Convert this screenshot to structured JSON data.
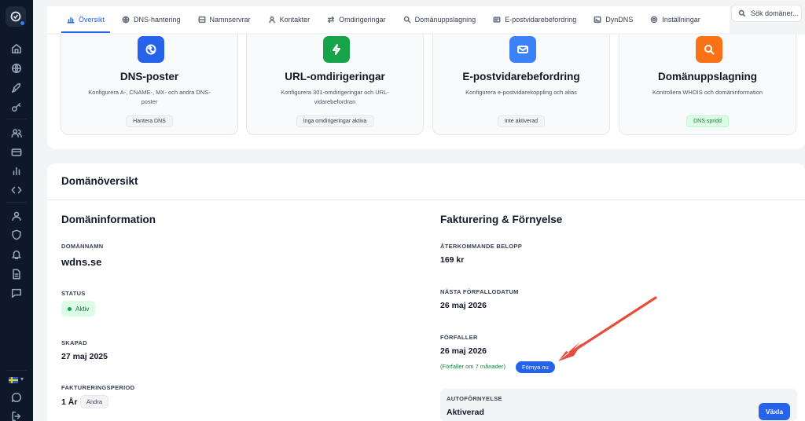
{
  "tabs": [
    {
      "label": "Översikt",
      "icon": "chart-icon",
      "active": true
    },
    {
      "label": "DNS-hantering",
      "icon": "globe-icon"
    },
    {
      "label": "Namnservrar",
      "icon": "server-icon"
    },
    {
      "label": "Kontakter",
      "icon": "user-icon"
    },
    {
      "label": "Omdirigeringar",
      "icon": "arrows-icon"
    },
    {
      "label": "Domänuppslagning",
      "icon": "search-icon"
    },
    {
      "label": "E-postvidarebefordring",
      "icon": "mail-icon"
    },
    {
      "label": "DynDNS",
      "icon": "terminal-icon"
    },
    {
      "label": "Inställningar",
      "icon": "gear-icon"
    }
  ],
  "search": {
    "placeholder": "Sök domäner..."
  },
  "services": [
    {
      "title": "DNS-poster",
      "desc": "Konfigurera A-, CNAME-, MX- och andra DNS-poster",
      "badge": "Hantera DNS",
      "color": "#2563eb",
      "icon": "dns-icon"
    },
    {
      "title": "URL-omdirigeringar",
      "desc": "Konfigurera 301-omdirigeringar och URL-vidarebefordran",
      "badge": "Inga omdirigeringar aktiva",
      "color": "#16a34a",
      "icon": "bolt-icon"
    },
    {
      "title": "E-postvidarebefordring",
      "desc": "Konfigurera e-postvidarekoppling och alias",
      "badge": "Inte aktiverad",
      "color": "#3b82f6",
      "icon": "mail-icon"
    },
    {
      "title": "Domänuppslagning",
      "desc": "Kontrollera WHOIS och domäninformation",
      "badge": "DNS spridd",
      "color": "#f97316",
      "icon": "search-icon"
    }
  ],
  "overview": {
    "title": "Domänöversikt",
    "domain_info": {
      "title": "Domäninformation",
      "domain_label": "DOMÄNNAMN",
      "domain_value": "wdns.se",
      "status_label": "STATUS",
      "status_value": "Aktiv",
      "created_label": "SKAPAD",
      "created_value": "27 maj 2025",
      "period_label": "FAKTURERINGSPERIOD",
      "period_value": "1 År",
      "change_label": "Ändra"
    },
    "billing": {
      "title": "Fakturering & Förnyelse",
      "amount_label": "ÅTERKOMMANDE BELOPP",
      "amount_value": "169 kr",
      "next_due_label": "NÄSTA FÖRFALLODATUM",
      "next_due_value": "26 maj 2026",
      "expires_label": "FÖRFALLER",
      "expires_value": "26 maj 2026",
      "expires_note": "(Förfaller om 7 månader)",
      "renew_label": "Förnya nu",
      "auto_label": "AUTOFÖRNYELSE",
      "auto_value": "Aktiverad",
      "toggle_label": "Växla"
    }
  },
  "colors": {
    "accent": "#2563eb",
    "success": "#16a34a",
    "annotation": "#e74c3c",
    "sidebar": "#0f172a"
  }
}
